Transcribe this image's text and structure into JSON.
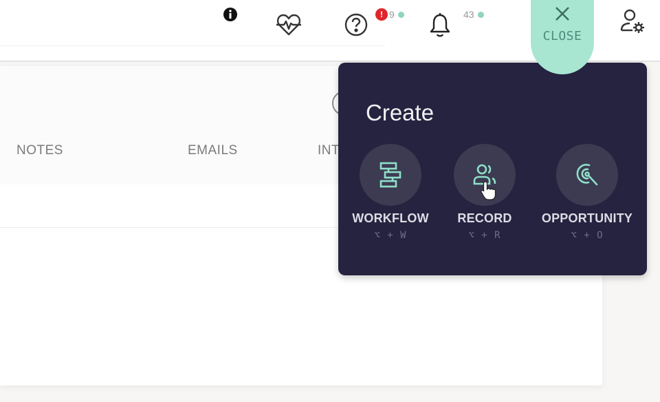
{
  "topbar": {
    "icons": {
      "info": "info-icon",
      "health": "heart-pulse-icon",
      "help": "help-circle-icon",
      "notifications": "bell-icon",
      "user_settings": "user-settings-icon"
    },
    "help_badge": {
      "alert": "!",
      "count": "9"
    },
    "notifications_badge": {
      "count": "43"
    },
    "close_button": {
      "label": "CLOSE",
      "icon": "close-icon"
    }
  },
  "content": {
    "tabs": [
      {
        "label": "NOTES"
      },
      {
        "label": "EMAILS"
      },
      {
        "label": "INT"
      }
    ]
  },
  "create_menu": {
    "title": "Create",
    "items": [
      {
        "label": "WORKFLOW",
        "shortcut": "⌥ + W",
        "icon": "workflow-icon"
      },
      {
        "label": "RECORD",
        "shortcut": "⌥ + R",
        "icon": "record-users-icon"
      },
      {
        "label": "OPPORTUNITY",
        "shortcut": "⌥ + O",
        "icon": "opportunity-target-icon"
      }
    ]
  },
  "colors": {
    "popover_bg": "#25233f",
    "accent_teal": "#a8e6d2",
    "icon_teal": "#8fe0c8",
    "alert_red": "#e0262b"
  }
}
